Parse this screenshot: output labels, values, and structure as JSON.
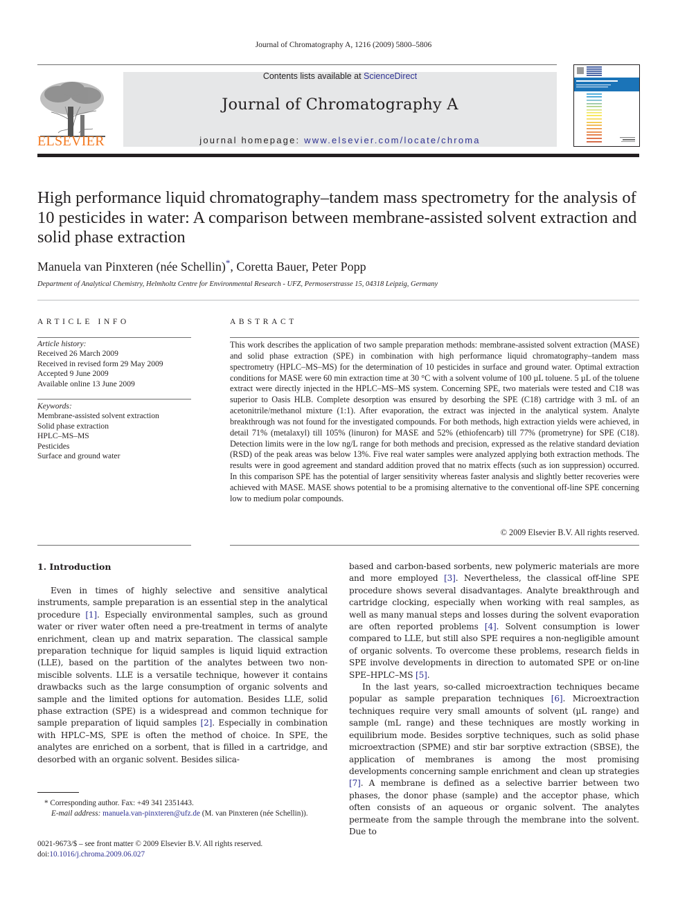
{
  "running_header": "Journal of Chromatography A, 1216 (2009) 5800–5806",
  "masthead": {
    "contents_prefix": "Contents lists available at ",
    "contents_link": "ScienceDirect",
    "journal_title": "Journal of Chromatography A",
    "homepage_prefix": "journal homepage: ",
    "homepage_link": "www.elsevier.com/locate/chroma",
    "publisher_logo_text": "ELSEVIER",
    "cover_title": "JOURNAL OF CHROMATOGRAPHY A"
  },
  "colors": {
    "link": "#2e3192",
    "elsevier_orange": "#f47920",
    "masthead_bg": "#e6e7e8"
  },
  "article": {
    "title": "High performance liquid chromatography–tandem mass spectrometry for the analysis of 10 pesticides in water: A comparison between membrane-assisted solvent extraction and solid phase extraction",
    "authors_main": "Manuela van Pinxteren (née Schellin)",
    "author_marker": "*",
    "authors_rest": ", Coretta Bauer, Peter Popp",
    "affiliation": "Department of Analytical Chemistry, Helmholtz Centre for Environmental Research - UFZ, Permoserstrasse 15, 04318 Leipzig, Germany"
  },
  "article_info": {
    "heading": "ARTICLE INFO",
    "history_label": "Article history:",
    "history": [
      "Received 26 March 2009",
      "Received in revised form 29 May 2009",
      "Accepted 9 June 2009",
      "Available online 13 June 2009"
    ],
    "keywords_label": "Keywords:",
    "keywords": [
      "Membrane-assisted solvent extraction",
      "Solid phase extraction",
      "HPLC–MS–MS",
      "Pesticides",
      "Surface and ground water"
    ]
  },
  "abstract": {
    "heading": "ABSTRACT",
    "text": "This work describes the application of two sample preparation methods: membrane-assisted solvent extraction (MASE) and solid phase extraction (SPE) in combination with high performance liquid chromatography–tandem mass spectrometry (HPLC–MS–MS) for the determination of 10 pesticides in surface and ground water. Optimal extraction conditions for MASE were 60 min extraction time at 30 °C with a solvent volume of 100 µL toluene. 5 µL of the toluene extract were directly injected in the HPLC–MS–MS system. Concerning SPE, two materials were tested and C18 was superior to Oasis HLB. Complete desorption was ensured by desorbing the SPE (C18) cartridge with 3 mL of an acetonitrile/methanol mixture (1:1). After evaporation, the extract was injected in the analytical system. Analyte breakthrough was not found for the investigated compounds. For both methods, high extraction yields were achieved, in detail 71% (metalaxyl) till 105% (linuron) for MASE and 52% (ethiofencarb) till 77% (prometryne) for SPE (C18). Detection limits were in the low ng/L range for both methods and precision, expressed as the relative standard deviation (RSD) of the peak areas was below 13%. Five real water samples were analyzed applying both extraction methods. The results were in good agreement and standard addition proved that no matrix effects (such as ion suppression) occurred. In this comparison SPE has the potential of larger sensitivity whereas faster analysis and slightly better recoveries were achieved with MASE. MASE shows potential to be a promising alternative to the conventional off-line SPE concerning low to medium polar compounds.",
    "copyright": "© 2009 Elsevier B.V. All rights reserved."
  },
  "introduction": {
    "heading": "1.  Introduction",
    "p1_a": "Even in times of highly selective and sensitive analytical instruments, sample preparation is an essential step in the analytical procedure ",
    "p1_ref1": "[1]",
    "p1_b": ". Especially environmental samples, such as ground water or river water often need a pre-treatment in terms of analyte enrichment, clean up and matrix separation. The classical sample preparation technique for liquid samples is liquid liquid extraction (LLE), based on the partition of the analytes between two non-miscible solvents. LLE is a versatile technique, however it contains drawbacks such as the large consumption of organic solvents and sample and the limited options for automation. Besides LLE, solid phase extraction (SPE) is a widespread and common technique for sample preparation of liquid samples ",
    "p1_ref2": "[2]",
    "p1_c": ". Especially in combination with HPLC–MS, SPE is often the method of choice. In SPE, the analytes are enriched on a sorbent, that is filled in a cartridge, and desorbed with an organic solvent. Besides silica-",
    "p1_cont_a": "based and carbon-based sorbents, new polymeric materials are more and more employed ",
    "p1_ref3": "[3]",
    "p1_cont_b": ". Nevertheless, the classical off-line SPE procedure shows several disadvantages. Analyte breakthrough and cartridge clocking, especially when working with real samples, as well as many manual steps and losses during the solvent evaporation are often reported problems ",
    "p1_ref4": "[4]",
    "p1_cont_c": ". Solvent consumption is lower compared to LLE, but still also SPE requires a non-negligible amount of organic solvents. To overcome these problems, research fields in SPE involve developments in direction to automated SPE or on-line SPE–HPLC–MS ",
    "p1_ref5": "[5]",
    "p1_cont_d": ".",
    "p2_a": "In the last years, so-called microextraction techniques became popular as sample preparation techniques ",
    "p2_ref6": "[6]",
    "p2_b": ". Microextraction techniques require very small amounts of solvent (µL range) and sample (mL range) and these techniques are mostly working in equilibrium mode. Besides sorptive techniques, such as solid phase microextraction (SPME) and stir bar sorptive extraction (SBSE), the application of membranes is among the most promising developments concerning sample enrichment and clean up strategies ",
    "p2_ref7": "[7]",
    "p2_c": ". A membrane is defined as a selective barrier between two phases, the donor phase (sample) and the acceptor phase, which often consists of an aqueous or organic solvent. The analytes permeate from the sample through the membrane into the solvent. Due to"
  },
  "footnotes": {
    "corresponding": "*  Corresponding author. Fax: +49 341 2351443.",
    "email_label": "E-mail address: ",
    "email": "manuela.van-pinxteren@ufz.de",
    "email_suffix": " (M. van Pinxteren (née Schellin)).",
    "front_matter": "0021-9673/$ – see front matter © 2009 Elsevier B.V. All rights reserved.",
    "doi_label": "doi:",
    "doi": "10.1016/j.chroma.2009.06.027"
  }
}
